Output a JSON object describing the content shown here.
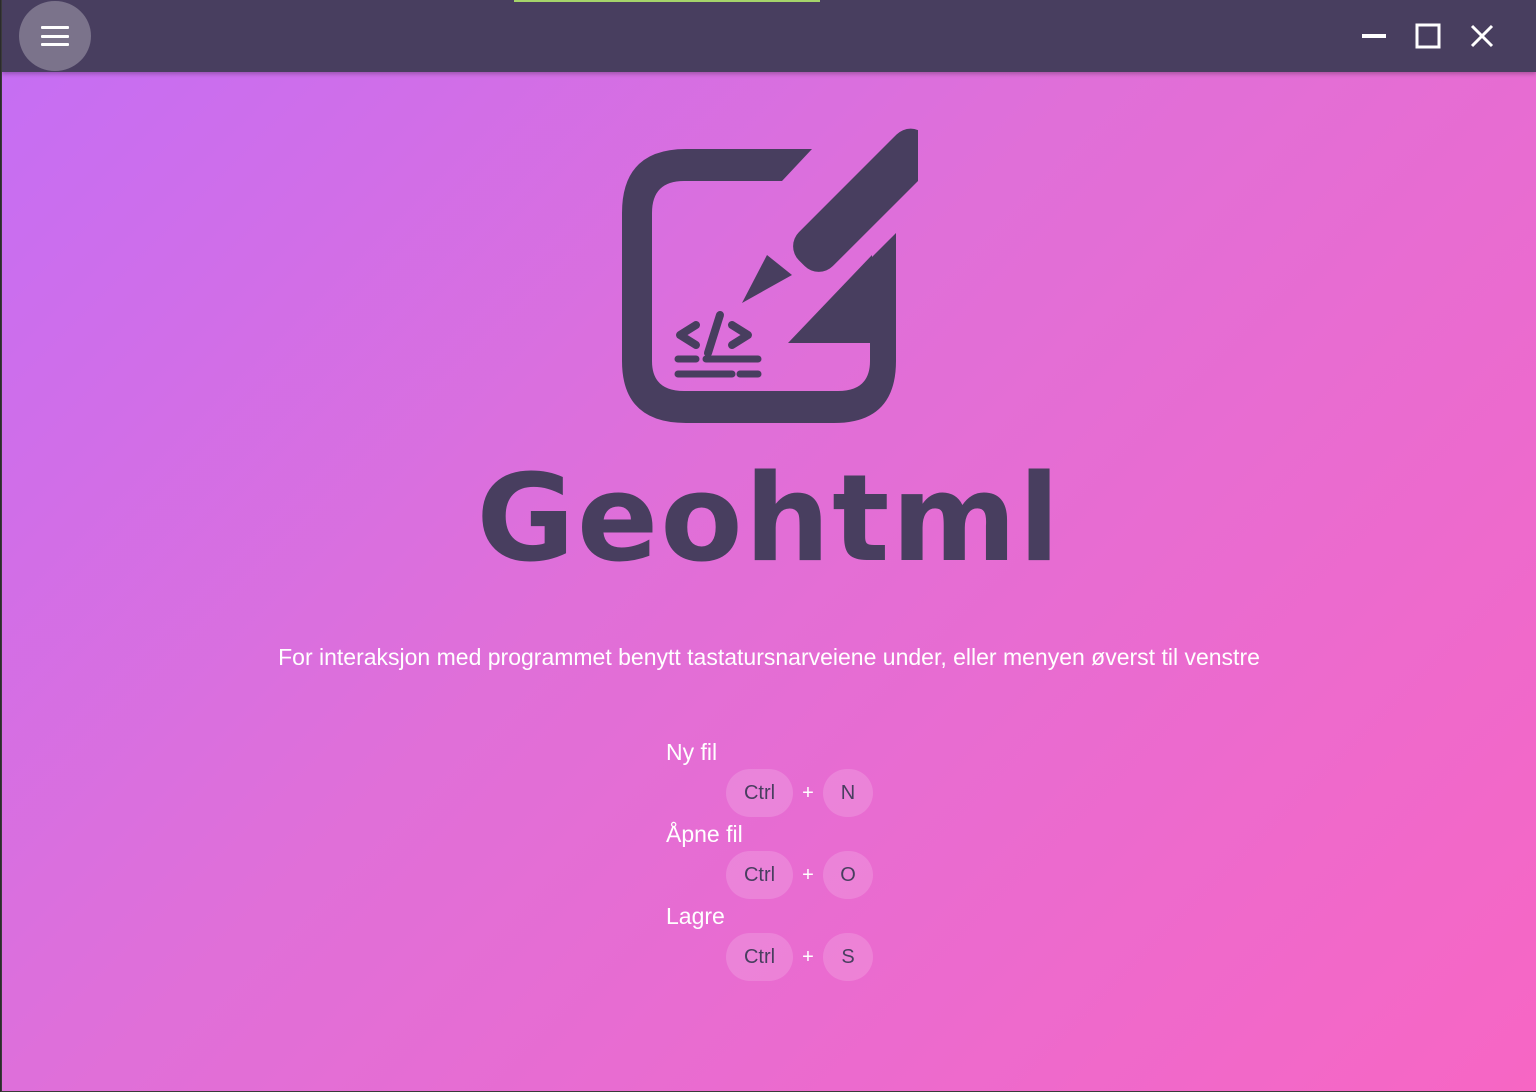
{
  "app": {
    "name": "Geohtml"
  },
  "titlebar": {
    "menu_icon": "hamburger-menu-icon",
    "controls": [
      "minimize-icon",
      "maximize-icon",
      "close-icon"
    ],
    "background": "#483e5f"
  },
  "colors": {
    "gradient_start": "#c46ef5",
    "gradient_end": "#f766c4",
    "accent_dark": "#483e5f"
  },
  "main": {
    "instruction": "For interaksjon med programmet benytt tastatursnarveiene under, eller menyen øverst til venstre",
    "shortcuts": [
      {
        "label": "Ny fil",
        "modifier": "Ctrl",
        "plus": "+",
        "key": "N"
      },
      {
        "label": "Åpne fil",
        "modifier": "Ctrl",
        "plus": "+",
        "key": "O"
      },
      {
        "label": "Lagre",
        "modifier": "Ctrl",
        "plus": "+",
        "key": "S"
      }
    ]
  }
}
